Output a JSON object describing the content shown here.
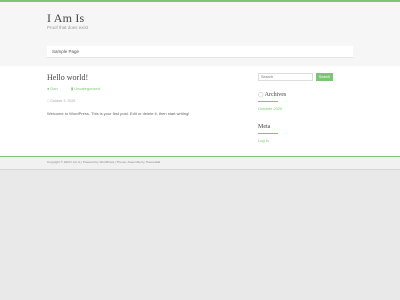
{
  "site": {
    "title": "I Am Is",
    "description": "Proof that does exist"
  },
  "nav": {
    "items": [
      {
        "label": "Sample Page"
      }
    ]
  },
  "post": {
    "title": "Hello world!",
    "author": "Dan",
    "category": "Uncategorized",
    "date": "October 3, 2020",
    "body": "Welcome to WordPress. This is your first post. Edit or delete it, then start writing!"
  },
  "sidebar": {
    "search": {
      "placeholder": "Search",
      "button_label": "Search"
    },
    "archives": {
      "title": "Archives",
      "items": [
        {
          "label": "October 2020"
        }
      ]
    },
    "meta": {
      "title": "Meta",
      "items": [
        {
          "label": "Log in"
        }
      ]
    }
  },
  "footer": {
    "copyright": "Copyright © 2020 I Am Is | Powered by WordPress | Theme: Assemble by ThemeHall"
  },
  "colors": {
    "accent": "#7cc576",
    "background": "#e9e9e9"
  }
}
